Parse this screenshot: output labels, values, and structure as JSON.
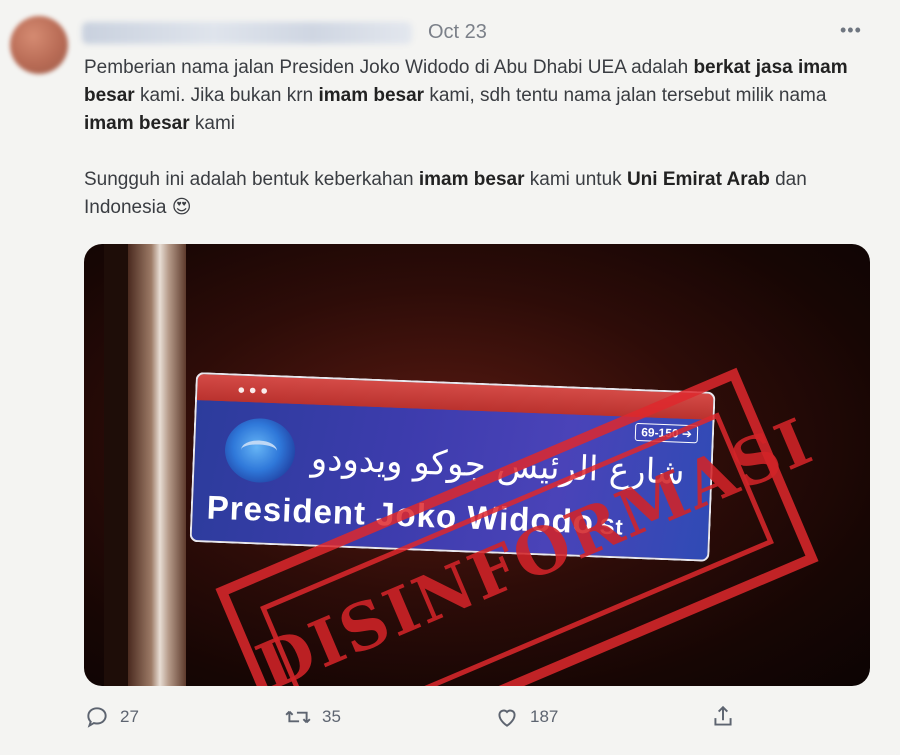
{
  "tweet": {
    "date": "Oct 23",
    "more_label": "•••",
    "line1_a": "Pemberian nama jalan Presiden Joko Widodo di Abu Dhabi UEA adalah",
    "line2_bold1": "berkat jasa imam besar",
    "line2_a": " kami. Jika bukan krn ",
    "line2_bold2": "imam besar",
    "line2_b": " kami, sdh",
    "line3_a": "tentu nama jalan tersebut milik nama ",
    "line3_bold": "imam besar",
    "line3_b": " kami",
    "para2_a": "Sungguh ini adalah bentuk keberkahan ",
    "para2_bold1": "imam besar",
    "para2_b": " kami untuk ",
    "para2_bold2": "Uni Emirat Arab",
    "para2_c": " dan Indonesia",
    "emoji": "😍"
  },
  "media": {
    "sign_number": "69-150 ➔",
    "sign_arabic": "شارع الرئيس جوكو ويدودو",
    "sign_english": "President Joko Widodo",
    "sign_english_suffix": "St",
    "stamp_text": "DISINFORMASI"
  },
  "actions": {
    "replies": "27",
    "retweets": "35",
    "likes": "187"
  },
  "icons": [
    "reply-icon",
    "retweet-icon",
    "like-icon",
    "share-icon",
    "more-icon"
  ],
  "colors": {
    "stamp_red": "#de282d",
    "sign_blue": "#3d3cad",
    "sign_red": "#c93b37",
    "background": "#f4f4f2"
  }
}
